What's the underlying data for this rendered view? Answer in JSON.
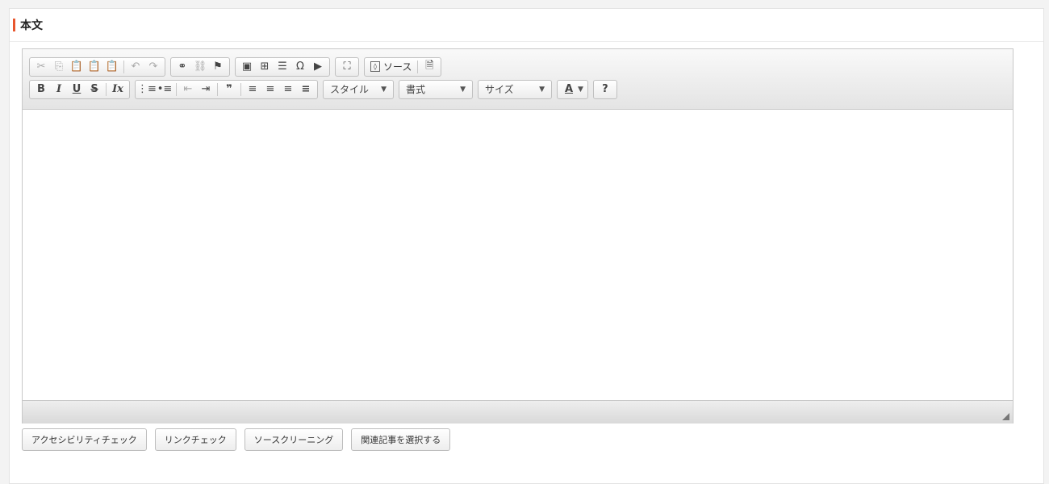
{
  "panel": {
    "title": "本文"
  },
  "toolbar": {
    "row1": {
      "cut": "✂",
      "copy": "⎘",
      "paste": "📋",
      "paste_text": "📋",
      "paste_word": "📋",
      "undo": "↶",
      "redo": "↷",
      "link": "⚭",
      "unlink": "⛓",
      "anchor": "⚑",
      "image": "▣",
      "table": "⊞",
      "hr": "☰",
      "special_char": "Ω",
      "video": "▶",
      "maximize": "⛶",
      "source_label": "ソース",
      "preview": "🗎"
    },
    "row2": {
      "bold": "B",
      "italic": "I",
      "underline": "U",
      "strike": "S",
      "remove_format": "Ix",
      "numbered_list": "⋮≡",
      "bulleted_list": "•≡",
      "outdent": "⇤",
      "indent": "⇥",
      "blockquote": "❞",
      "align_left": "≡",
      "align_center": "≡",
      "align_right": "≡",
      "align_justify": "≡",
      "style_label": "スタイル",
      "format_label": "書式",
      "size_label": "サイズ",
      "text_color": "A",
      "help": "?"
    }
  },
  "actions": {
    "accessibility_check": "アクセシビリティチェック",
    "link_check": "リンクチェック",
    "source_cleaning": "ソースクリーニング",
    "select_related": "関連記事を選択する"
  }
}
